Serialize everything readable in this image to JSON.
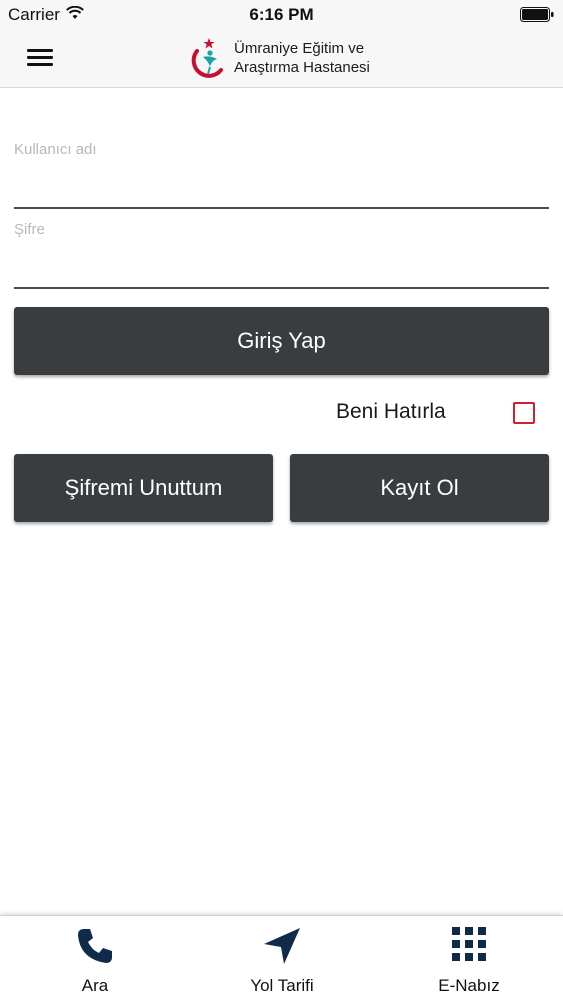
{
  "status_bar": {
    "carrier": "Carrier",
    "time": "6:16 PM"
  },
  "header": {
    "title_line1": "Ümraniye Eğitim ve",
    "title_line2": "Araştırma Hastanesi",
    "menu_icon": "hamburger-menu-icon",
    "logo_icon": "hospital-logo-icon"
  },
  "form": {
    "username_placeholder": "Kullanıcı adı",
    "username_value": "",
    "password_placeholder": "Şifre",
    "password_value": "",
    "login_label": "Giriş Yap",
    "remember_label": "Beni Hatırla",
    "remember_checked": false,
    "forgot_label": "Şifremi Unuttum",
    "register_label": "Kayıt Ol"
  },
  "tab_bar": {
    "items": [
      {
        "label": "Ara",
        "icon": "phone-icon"
      },
      {
        "label": "Yol Tarifi",
        "icon": "navigation-arrow-icon"
      },
      {
        "label": "E-Nabız",
        "icon": "grid-icon"
      }
    ]
  },
  "colors": {
    "button_bg": "#3a3d40",
    "checkbox_border": "#d21f2b",
    "tab_icon": "#0f2a4a",
    "logo_red": "#c8102e",
    "logo_teal": "#1aa3a3"
  }
}
